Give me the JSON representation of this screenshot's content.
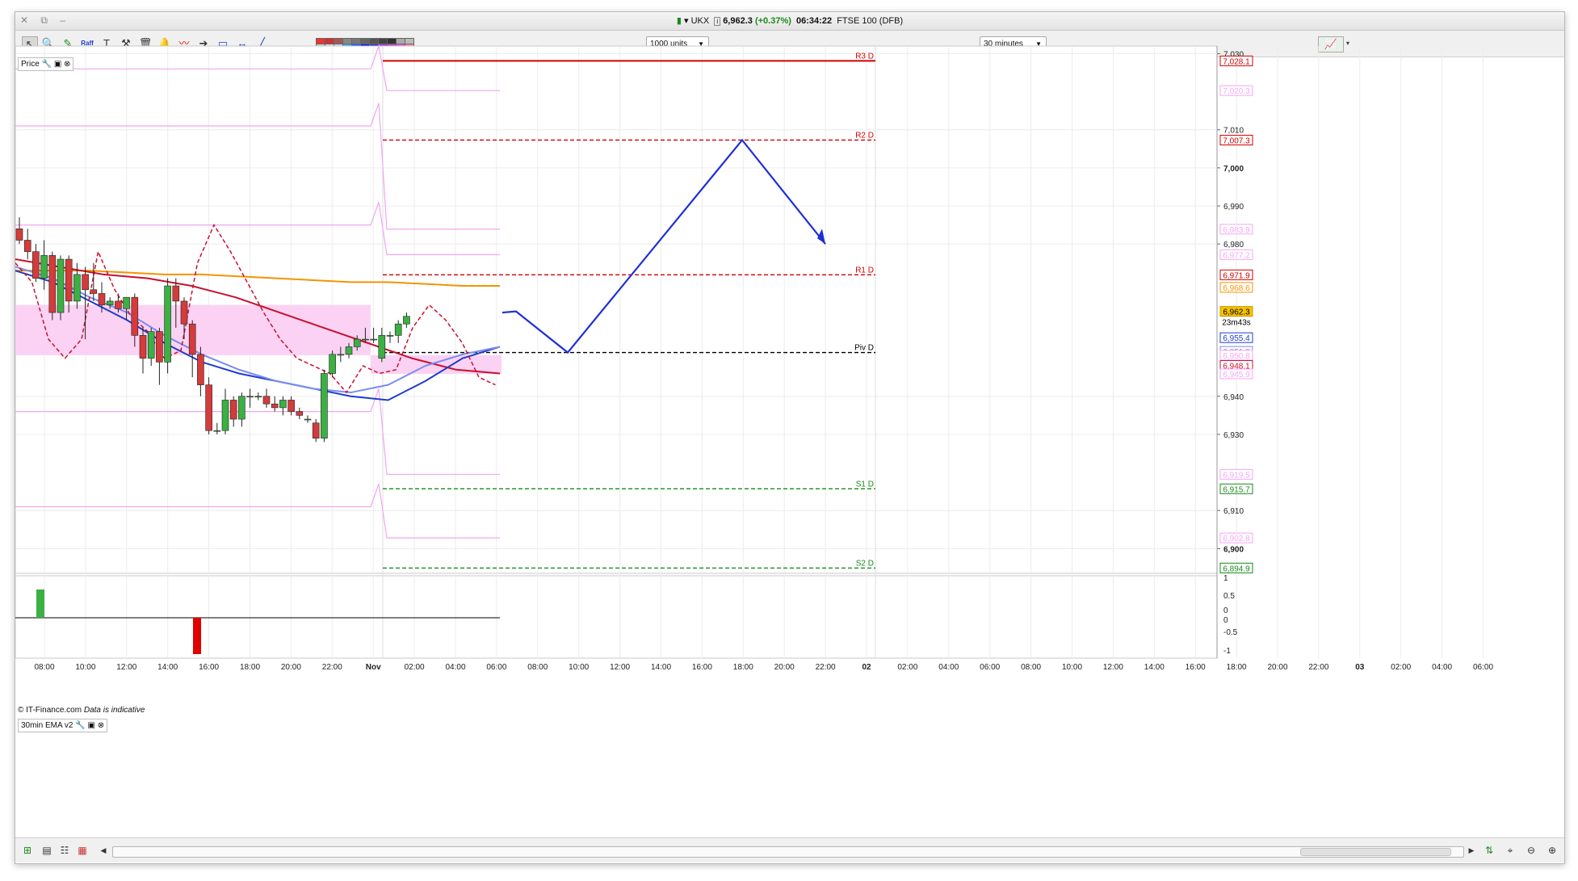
{
  "window": {
    "controls": "✕ ⧉ –"
  },
  "title": {
    "symbol": "UKX",
    "price": "6,962.3",
    "change": "(+0.37%)",
    "time": "06:34:22",
    "name": "FTSE 100 (DFB)"
  },
  "toolbar": {
    "units_select": "1000 units",
    "interval_select": "30 minutes",
    "tools": [
      "pointer-icon",
      "zoom-icon",
      "draw-icon",
      "raff-icon",
      "text-icon",
      "tools-icon",
      "delete-icon",
      "alert-icon",
      "indicator-icon",
      "arrow-icon",
      "shape-icon",
      "measure-icon",
      "trendline-icon"
    ],
    "raff_label": "Raff",
    "swatch_colors": [
      "#e33",
      "#c33",
      "#a55",
      "#888",
      "#777",
      "#666",
      "#555",
      "#444",
      "#333",
      "#aaa",
      "#bbb",
      "#ccc",
      "#ddd",
      "#cde",
      "#4af",
      "#26f",
      "#11f",
      "#33c",
      "#a3f",
      "#c4c",
      "#e5e",
      "#f8a"
    ]
  },
  "panels": {
    "price_label": "Price",
    "indicator_label": "30min EMA v2",
    "copyright": "© IT-Finance.com",
    "disclaimer": "Data is indicative"
  },
  "chart_data": {
    "type": "candlestick",
    "instrument": "FTSE 100 (DFB)",
    "interval": "30 minutes",
    "y_axis": {
      "ticks": [
        7030,
        7010,
        7000,
        6990,
        6980,
        6940,
        6930,
        6910,
        6900
      ],
      "ylim": [
        6895,
        7032
      ]
    },
    "x_axis": {
      "ticks": [
        "08:00",
        "10:00",
        "12:00",
        "14:00",
        "16:00",
        "18:00",
        "20:00",
        "22:00",
        "Nov",
        "02:00",
        "04:00",
        "06:00",
        "08:00",
        "10:00",
        "12:00",
        "14:00",
        "16:00",
        "18:00",
        "20:00",
        "22:00",
        "02",
        "02:00",
        "04:00",
        "06:00",
        "08:00",
        "10:00",
        "12:00",
        "14:00",
        "16:00",
        "18:00",
        "20:00",
        "22:00",
        "03",
        "02:00",
        "04:00",
        "06:00"
      ]
    },
    "candles": [
      {
        "o": 6984,
        "h": 6987,
        "l": 6980,
        "c": 6981
      },
      {
        "o": 6981,
        "h": 6984,
        "l": 6976,
        "c": 6978
      },
      {
        "o": 6978,
        "h": 6980,
        "l": 6970,
        "c": 6971
      },
      {
        "o": 6971,
        "h": 6981,
        "l": 6968,
        "c": 6977
      },
      {
        "o": 6977,
        "h": 6978,
        "l": 6960,
        "c": 6962
      },
      {
        "o": 6962,
        "h": 6977,
        "l": 6960,
        "c": 6976
      },
      {
        "o": 6976,
        "h": 6977,
        "l": 6962,
        "c": 6965
      },
      {
        "o": 6965,
        "h": 6975,
        "l": 6963,
        "c": 6972
      },
      {
        "o": 6972,
        "h": 6974,
        "l": 6955,
        "c": 6968
      },
      {
        "o": 6968,
        "h": 6975,
        "l": 6965,
        "c": 6967
      },
      {
        "o": 6967,
        "h": 6970,
        "l": 6962,
        "c": 6964
      },
      {
        "o": 6964,
        "h": 6966,
        "l": 6963,
        "c": 6965
      },
      {
        "o": 6965,
        "h": 6967,
        "l": 6962,
        "c": 6963
      },
      {
        "o": 6963,
        "h": 6966,
        "l": 6960,
        "c": 6966
      },
      {
        "o": 6966,
        "h": 6967,
        "l": 6953,
        "c": 6956
      },
      {
        "o": 6956,
        "h": 6958,
        "l": 6946,
        "c": 6950
      },
      {
        "o": 6950,
        "h": 6958,
        "l": 6948,
        "c": 6957
      },
      {
        "o": 6957,
        "h": 6958,
        "l": 6943,
        "c": 6949
      },
      {
        "o": 6949,
        "h": 6971,
        "l": 6946,
        "c": 6969
      },
      {
        "o": 6969,
        "h": 6971,
        "l": 6958,
        "c": 6965
      },
      {
        "o": 6965,
        "h": 6966,
        "l": 6955,
        "c": 6959
      },
      {
        "o": 6959,
        "h": 6960,
        "l": 6945,
        "c": 6951
      },
      {
        "o": 6951,
        "h": 6953,
        "l": 6940,
        "c": 6943
      },
      {
        "o": 6943,
        "h": 6945,
        "l": 6930,
        "c": 6931
      },
      {
        "o": 6931,
        "h": 6933,
        "l": 6930,
        "c": 6931
      },
      {
        "o": 6931,
        "h": 6942,
        "l": 6930,
        "c": 6939
      },
      {
        "o": 6939,
        "h": 6940,
        "l": 6932,
        "c": 6934
      },
      {
        "o": 6934,
        "h": 6941,
        "l": 6932,
        "c": 6940
      },
      {
        "o": 6940,
        "h": 6942,
        "l": 6937,
        "c": 6940
      },
      {
        "o": 6940,
        "h": 6941,
        "l": 6939,
        "c": 6940
      },
      {
        "o": 6940,
        "h": 6942,
        "l": 6937,
        "c": 6938
      },
      {
        "o": 6938,
        "h": 6940,
        "l": 6936,
        "c": 6937
      },
      {
        "o": 6937,
        "h": 6940,
        "l": 6935,
        "c": 6939
      },
      {
        "o": 6939,
        "h": 6940,
        "l": 6935,
        "c": 6936
      },
      {
        "o": 6936,
        "h": 6937,
        "l": 6934,
        "c": 6935
      },
      {
        "o": 6934,
        "h": 6935,
        "l": 6933,
        "c": 6934
      },
      {
        "o": 6933,
        "h": 6934,
        "l": 6928,
        "c": 6929
      },
      {
        "o": 6929,
        "h": 6947,
        "l": 6928,
        "c": 6946
      },
      {
        "o": 6946,
        "h": 6952,
        "l": 6945,
        "c": 6951
      },
      {
        "o": 6951,
        "h": 6953,
        "l": 6949,
        "c": 6951
      },
      {
        "o": 6951,
        "h": 6954,
        "l": 6950,
        "c": 6953
      },
      {
        "o": 6953,
        "h": 6956,
        "l": 6952,
        "c": 6955
      },
      {
        "o": 6955,
        "h": 6958,
        "l": 6954,
        "c": 6955
      },
      {
        "o": 6955,
        "h": 6958,
        "l": 6954,
        "c": 6955
      },
      {
        "o": 6950,
        "h": 6958,
        "l": 6949,
        "c": 6956
      },
      {
        "o": 6956,
        "h": 6957,
        "l": 6954,
        "c": 6956
      },
      {
        "o": 6956,
        "h": 6960,
        "l": 6954,
        "c": 6959
      },
      {
        "o": 6959,
        "h": 6962,
        "l": 6958,
        "c": 6961
      }
    ],
    "series": [
      {
        "name": "orange",
        "color": "#f39400",
        "values": [
          6973,
          6973,
          6973,
          6972.5,
          6972,
          6972,
          6971.5,
          6971,
          6970.5,
          6970,
          6970,
          6969.5,
          6969,
          6969
        ]
      },
      {
        "name": "red",
        "color": "#c8102e",
        "values": [
          6976,
          6974,
          6972,
          6971,
          6969,
          6966,
          6962,
          6958,
          6954,
          6950,
          6947,
          6946
        ]
      },
      {
        "name": "blue",
        "color": "#1e3ccc",
        "values": [
          6973,
          6970,
          6965,
          6960,
          6954,
          6949,
          6946,
          6944,
          6942,
          6940,
          6939,
          6944,
          6950,
          6953
        ]
      },
      {
        "name": "lightblue",
        "color": "#7a8cf0",
        "values": [
          6974,
          6971,
          6966,
          6962,
          6956,
          6951,
          6947,
          6944,
          6942,
          6941,
          6943,
          6948,
          6951,
          6953
        ]
      }
    ],
    "pivot_levels": [
      {
        "label": "R3 D",
        "value": 7028.1,
        "color": "#d00000",
        "style": "solid"
      },
      {
        "label": "R2 D",
        "value": 7007.3,
        "color": "#d00000",
        "style": "dashed"
      },
      {
        "label": "R1 D",
        "value": 6971.9,
        "color": "#d00000",
        "style": "dashed"
      },
      {
        "label": "Piv D",
        "value": 6951.5,
        "color": "#000000",
        "style": "dashed"
      },
      {
        "label": "S1 D",
        "value": 6915.7,
        "color": "#1a8a1a",
        "style": "dashed"
      },
      {
        "label": "S2 D",
        "value": 6894.9,
        "color": "#1a8a1a",
        "style": "dashed"
      }
    ],
    "price_tags": [
      {
        "text": "7,028.1",
        "color": "#d00000",
        "value": 7028.1
      },
      {
        "text": "7,020.3",
        "color": "#f6a6f6",
        "value": 7020.3
      },
      {
        "text": "7,007.3",
        "color": "#d00000",
        "value": 7007.3
      },
      {
        "text": "6,983.9",
        "color": "#f6a6f6",
        "value": 6983.9
      },
      {
        "text": "6,977.2",
        "color": "#f6a6f6",
        "value": 6977.2
      },
      {
        "text": "6,971.9",
        "color": "#d00000",
        "value": 6971.9
      },
      {
        "text": "6,968.6",
        "color": "#f39400",
        "value": 6968.6
      },
      {
        "text": "6,962.3",
        "color": "#f6c200",
        "value": 6962.3
      },
      {
        "text": "6,955.4",
        "color": "#1e3ccc",
        "value": 6955.4
      },
      {
        "text": "6,951.8",
        "color": "#7a8cf0",
        "value": 6951.8
      },
      {
        "text": "6,950.8",
        "color": "#f6a6f6",
        "value": 6950.8
      },
      {
        "text": "6,948.1",
        "color": "#c8102e",
        "value": 6948.1
      },
      {
        "text": "6,945.9",
        "color": "#f6a6f6",
        "value": 6945.9
      },
      {
        "text": "6,919.5",
        "color": "#f6a6f6",
        "value": 6919.5
      },
      {
        "text": "6,915.7",
        "color": "#1a8a1a",
        "value": 6915.7
      },
      {
        "text": "6,902.8",
        "color": "#f6a6f6",
        "value": 6902.8
      },
      {
        "text": "6,894.9",
        "color": "#1a8a1a",
        "value": 6894.9
      }
    ],
    "countdown": "23m43s",
    "projection": {
      "color": "#1e2fd6",
      "points": [
        6962.3,
        6951.5,
        7007.3,
        6980
      ]
    },
    "indicator": {
      "title": "30min EMA v2",
      "ticks": [
        "1",
        "0.5",
        "0",
        "0",
        "-0.5",
        "-1"
      ],
      "bars": [
        {
          "value": 1,
          "color": "#3cb043"
        },
        {
          "value": -1,
          "color": "#e00000"
        }
      ]
    }
  },
  "statusbar": {
    "icons": [
      "layout-icon",
      "chart-icon",
      "list-icon",
      "grid-icon",
      "scroll-left-icon",
      "scroll-right-icon",
      "autoscale-icon",
      "crosshair-icon",
      "zoom-out-icon",
      "zoom-in-icon"
    ]
  }
}
